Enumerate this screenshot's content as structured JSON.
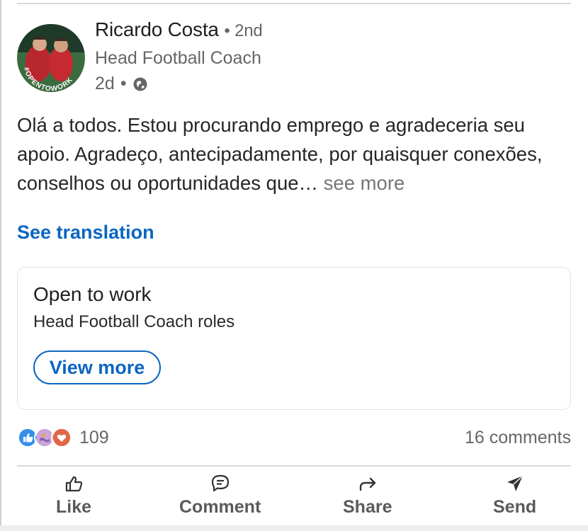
{
  "author": {
    "name": "Ricardo Costa",
    "degree": "• 2nd",
    "headline": "Head Football Coach",
    "time": "2d",
    "visibility_separator": "•",
    "avatar_badge_text": "#OPENTOWORK",
    "visibility_icon": "globe-icon"
  },
  "post": {
    "text": "Olá a todos. Estou procurando emprego e agradeceria seu apoio. Agradeço, antecipadamente, por quaisquer conexões, conselhos ou oportunidades que…",
    "see_more_label": " see more",
    "see_translation_label": "See translation"
  },
  "card": {
    "title": "Open to work",
    "subtitle": "Head Football Coach roles",
    "button_label": "View more"
  },
  "social": {
    "reaction_icons": [
      "like-reaction-icon",
      "support-reaction-icon",
      "love-reaction-icon"
    ],
    "reaction_count": "109",
    "comments_label": "16 comments"
  },
  "actions": [
    {
      "label": "Like",
      "icon": "thumbs-up-icon"
    },
    {
      "label": "Comment",
      "icon": "comment-icon"
    },
    {
      "label": "Share",
      "icon": "share-arrow-icon"
    },
    {
      "label": "Send",
      "icon": "send-icon"
    }
  ],
  "colors": {
    "link_blue": "#0a66c2",
    "open_to_work_green": "#2d7a3e",
    "secondary_text": "#666666",
    "love_orange": "#e06847",
    "support_purple": "#c9a5d9"
  }
}
